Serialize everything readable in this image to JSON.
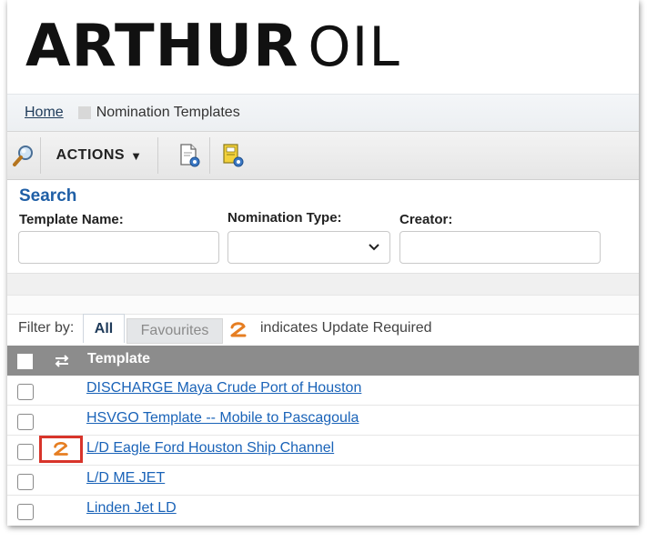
{
  "logo": {
    "bold": "ARTHUR",
    "thin": "OIL"
  },
  "breadcrumb": {
    "home": "Home",
    "current": "Nomination Templates"
  },
  "toolbar": {
    "search_icon": "magnifier-icon",
    "actions_label": "ACTIONS",
    "icon1": "document-gear-icon",
    "icon2": "template-gear-icon"
  },
  "search": {
    "title": "Search",
    "template_name_label": "Template Name:",
    "template_name_value": "",
    "nomination_type_label": "Nomination Type:",
    "nomination_type_value": "",
    "creator_label": "Creator:",
    "creator_value": ""
  },
  "filter": {
    "label": "Filter by:",
    "tab_all": "All",
    "tab_favourites": "Favourites",
    "legend_text": "indicates Update Required"
  },
  "table": {
    "header_template": "Template",
    "rows": [
      {
        "name": "DISCHARGE Maya Crude Port of Houston",
        "update_required": false
      },
      {
        "name": "HSVGO Template -- Mobile to Pascagoula",
        "update_required": false
      },
      {
        "name": "L/D Eagle Ford Houston Ship Channel",
        "update_required": true
      },
      {
        "name": "L/D ME JET",
        "update_required": false
      },
      {
        "name": "Linden Jet LD",
        "update_required": false
      }
    ]
  },
  "colors": {
    "accent": "#1f5fa6",
    "link": "#1a63b8",
    "update_icon": "#e67e22",
    "highlight": "#d8342a",
    "header": "#8c8c8c"
  }
}
